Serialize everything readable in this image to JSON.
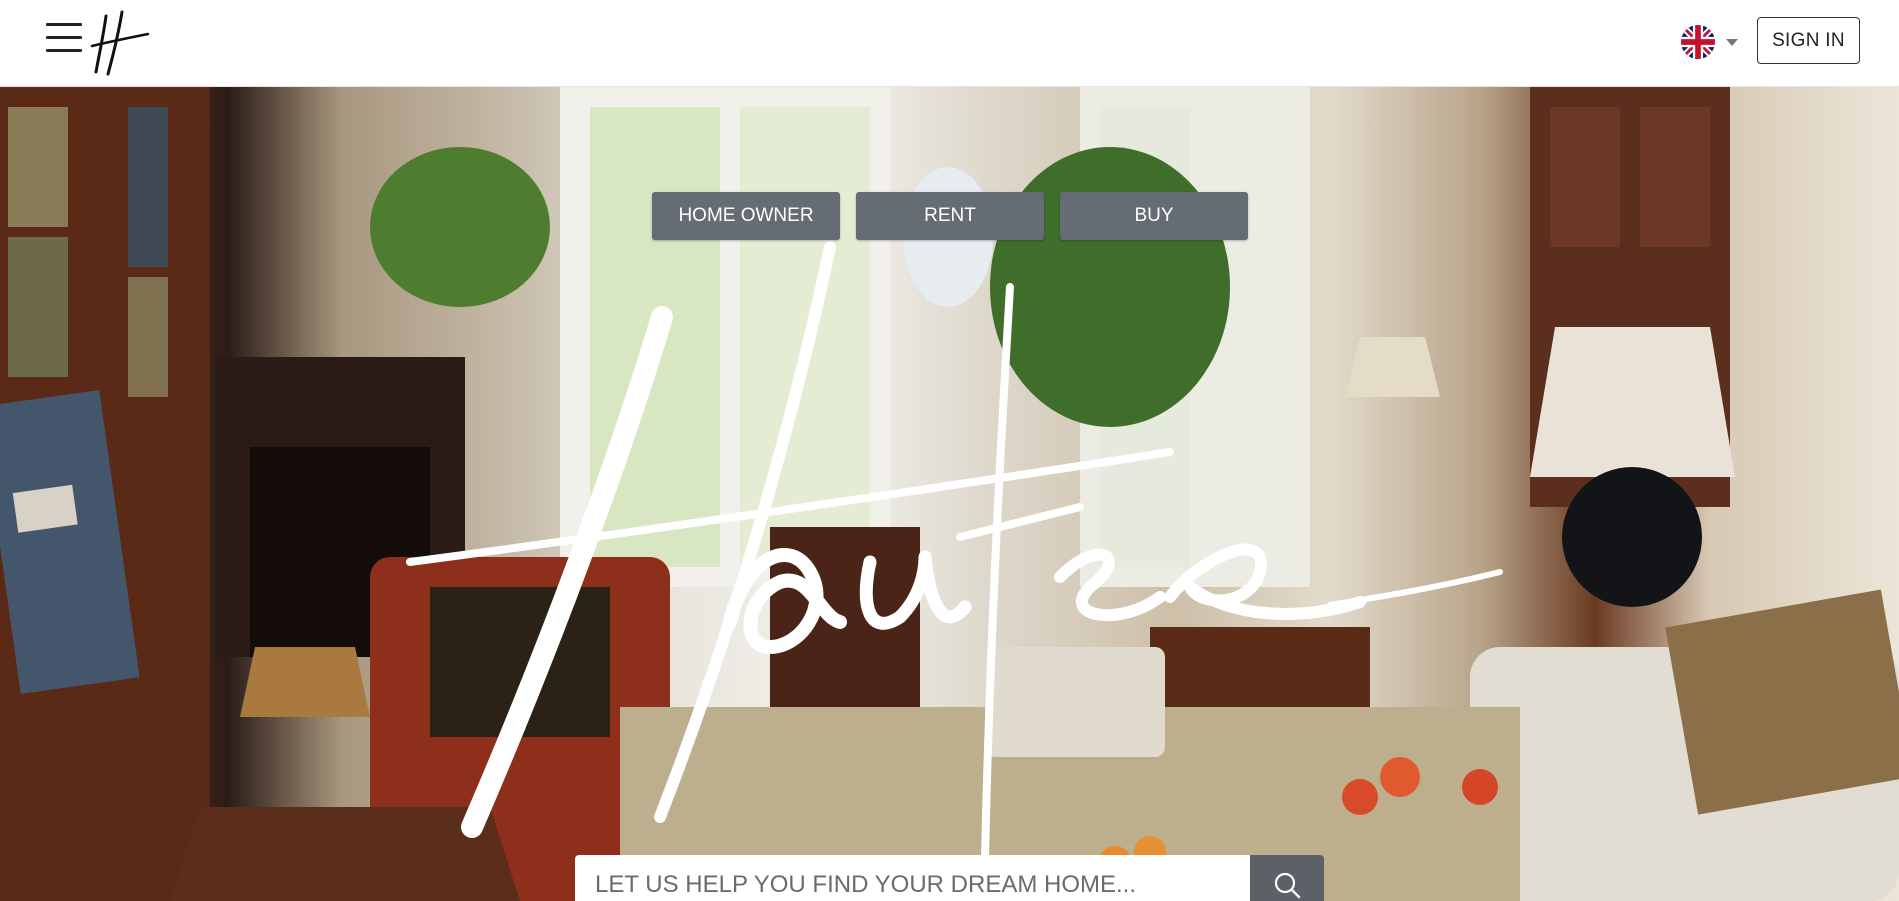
{
  "header": {
    "menu_icon": "hamburger-menu-icon",
    "logo_icon": "hautse-monogram-logo",
    "language": {
      "flag_icon": "uk-flag-icon",
      "caret_icon": "caret-down-icon"
    },
    "signin_label": "SIGN IN"
  },
  "hero": {
    "tabs": [
      {
        "label": "HOME OWNER"
      },
      {
        "label": "RENT"
      },
      {
        "label": "BUY"
      }
    ],
    "brand_script_icon": "hautse-script-logo",
    "search": {
      "placeholder": "LET US HELP YOU FIND YOUR DREAM HOME...",
      "value": "",
      "button_icon": "search-icon"
    }
  },
  "colors": {
    "tab_bg": "#666c73",
    "search_btn_bg": "#5c6168",
    "header_bg": "#ffffff"
  }
}
